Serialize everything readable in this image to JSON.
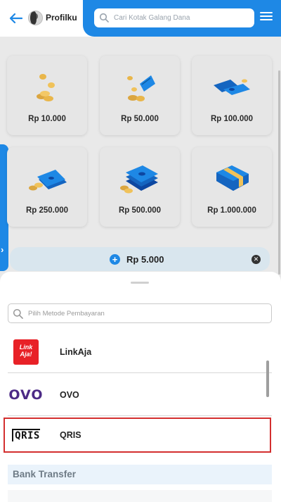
{
  "header": {
    "profile_label": "Profilku",
    "search_placeholder": "Cari Kotak Galang Dana"
  },
  "amounts": [
    {
      "label": "Rp 10.000"
    },
    {
      "label": "Rp 50.000"
    },
    {
      "label": "Rp 100.000"
    },
    {
      "label": "Rp 250.000"
    },
    {
      "label": "Rp 500.000"
    },
    {
      "label": "Rp 1.000.000"
    }
  ],
  "custom_amount": {
    "value": "Rp 5.000"
  },
  "payment_sheet": {
    "search_placeholder": "Pilih Metode Pembayaran",
    "methods": [
      {
        "name": "LinkAja",
        "logo_text": "Link Aja!"
      },
      {
        "name": "OVO",
        "logo_text": "OVO"
      },
      {
        "name": "QRIS",
        "logo_text": "QRIS",
        "selected": true
      }
    ],
    "section_title": "Bank Transfer"
  },
  "colors": {
    "primary": "#1e88e5",
    "selected_outline": "#d32f2f",
    "linkaja": "#e82127",
    "ovo": "#4c2a86"
  },
  "icons": {
    "back": "arrow-left-icon",
    "search": "search-icon",
    "menu": "hamburger-menu-icon",
    "side_tab": "chevron-right-icon",
    "add": "plus-icon",
    "clear": "close-icon"
  }
}
